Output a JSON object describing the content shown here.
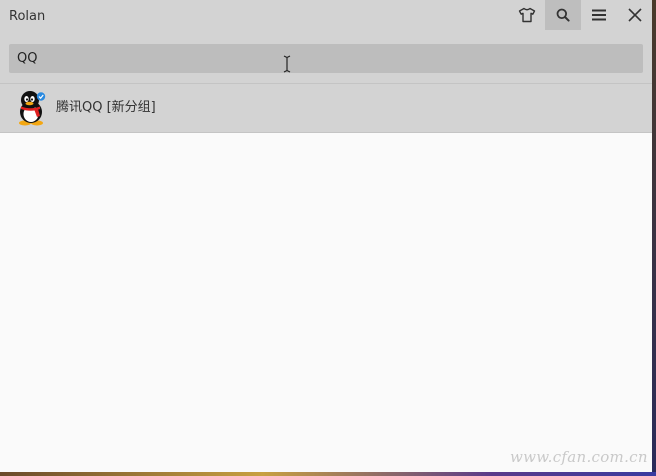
{
  "window": {
    "title": "Rolan"
  },
  "toolbar": {
    "buttons": [
      {
        "name": "skin-button",
        "icon": "tshirt-icon"
      },
      {
        "name": "search-button",
        "icon": "search-icon",
        "active": true
      },
      {
        "name": "menu-button",
        "icon": "hamburger-menu-icon"
      },
      {
        "name": "close-button",
        "icon": "close-icon"
      }
    ]
  },
  "search": {
    "value": "QQ",
    "placeholder": ""
  },
  "results": [
    {
      "label": "腾讯QQ [新分组]",
      "icon": "qq-penguin-icon"
    }
  ],
  "colors": {
    "titlebar": "#d3d3d3",
    "search_field": "#bdbdbd",
    "active_button": "#bebebe",
    "body": "#fafafa"
  },
  "watermark": "www.cfan.com.cn"
}
